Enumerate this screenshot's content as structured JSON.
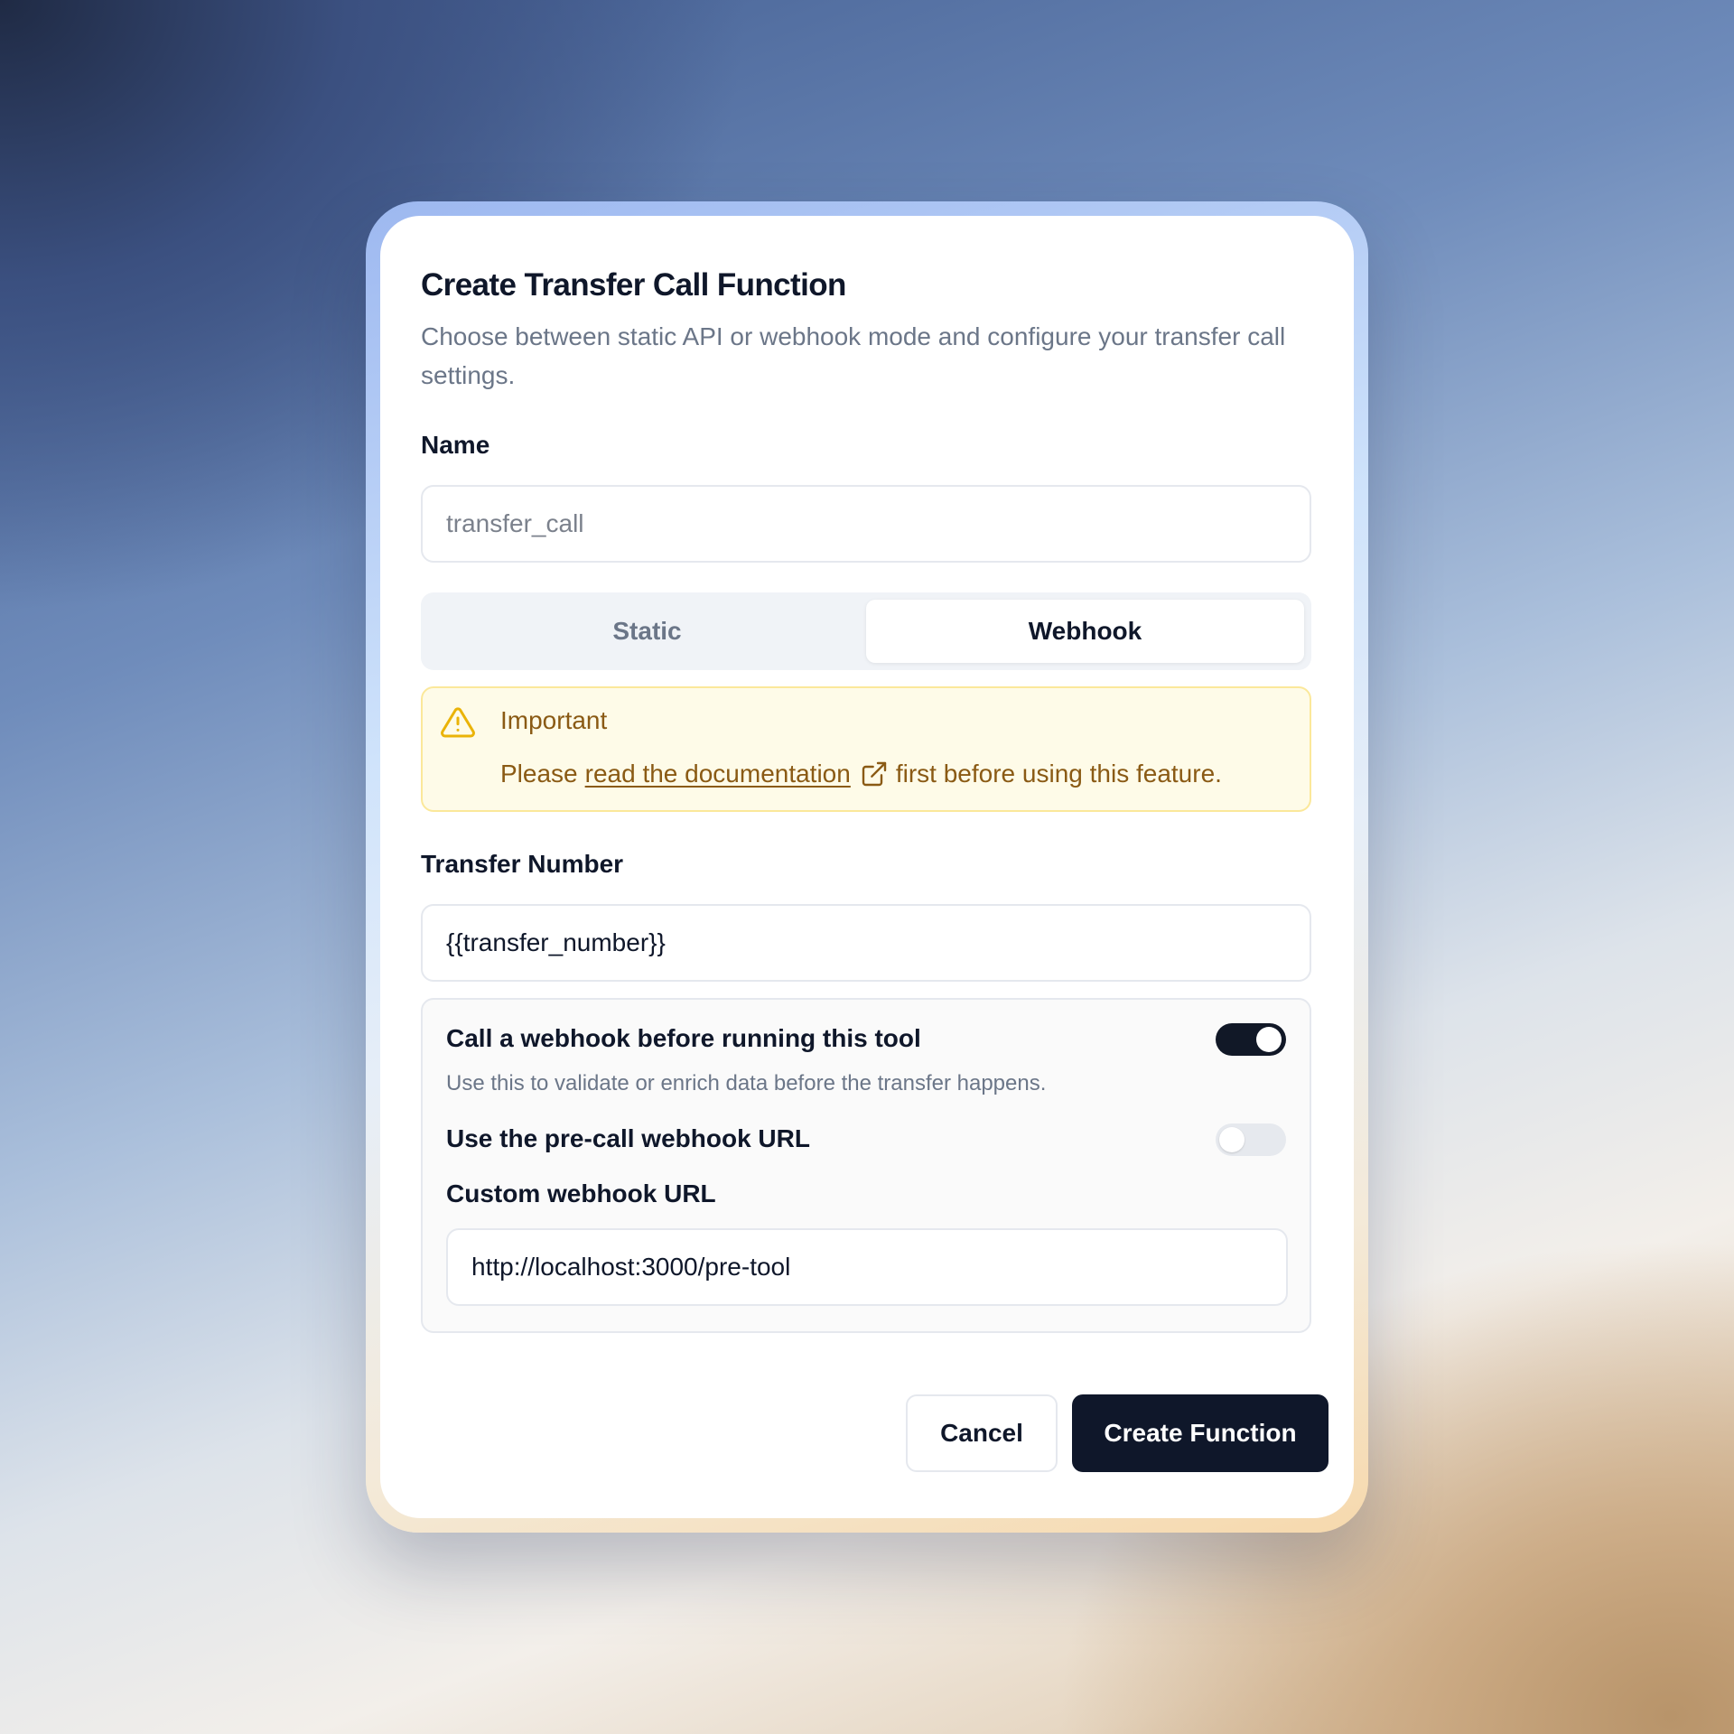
{
  "dialog": {
    "title": "Create Transfer Call Function",
    "subtitle": "Choose between static API or webhook mode and configure your transfer call settings."
  },
  "name_field": {
    "label": "Name",
    "value": "transfer_call"
  },
  "mode_tabs": {
    "items": [
      {
        "label": "Static",
        "active": false
      },
      {
        "label": "Webhook",
        "active": true
      }
    ]
  },
  "alert": {
    "icon": "warning-triangle-icon",
    "title": "Important",
    "prefix": "Please",
    "link_text": "read the documentation",
    "link_icon": "external-link-icon",
    "suffix": "first before using this feature."
  },
  "transfer_number": {
    "label": "Transfer Number",
    "value": "{{transfer_number}}"
  },
  "webhook_panel": {
    "call_webhook_label": "Call a webhook before running this tool",
    "call_webhook_enabled": true,
    "call_webhook_description": "Use this to validate or enrich data before the transfer happens.",
    "use_precall_label": "Use the pre-call webhook URL",
    "use_precall_enabled": false,
    "custom_url_label": "Custom webhook URL",
    "custom_url_value": "http://localhost:3000/pre-tool"
  },
  "actions": {
    "cancel_label": "Cancel",
    "create_label": "Create Function"
  },
  "colors": {
    "primary": "#0f172a",
    "alert_bg": "#fefbe8",
    "alert_text": "#8a5a14",
    "alert_icon": "#eab308"
  }
}
